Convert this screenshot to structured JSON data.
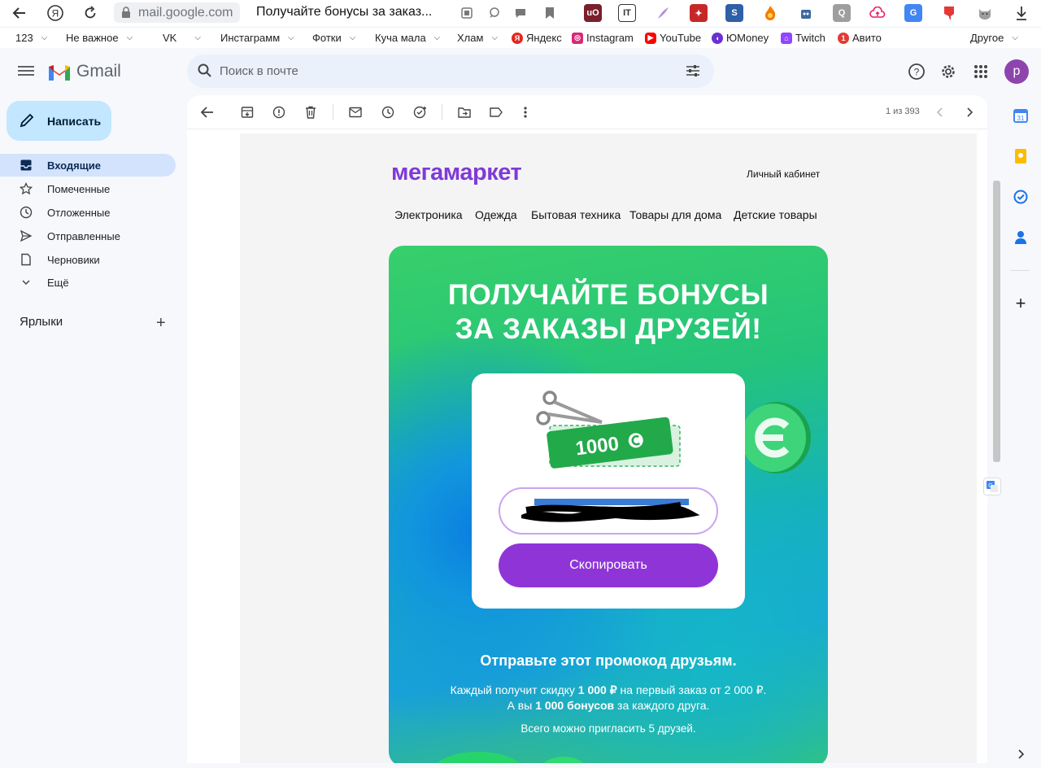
{
  "browser": {
    "url": "mail.google.com",
    "tab_title": "Получайте бонусы за заказ...",
    "extensions": [
      "ublock-icon",
      "it-icon",
      "feather-icon",
      "magic-wand-icon",
      "s-icon",
      "fire-icon",
      "robot-icon",
      "q-icon",
      "cloud-icon",
      "translate-icon",
      "pin-icon",
      "cat-icon"
    ]
  },
  "bookmarks": [
    {
      "label": "123",
      "folder": true
    },
    {
      "label": "Не важное",
      "folder": true
    },
    {
      "label": "VK",
      "folder": true
    },
    {
      "label": "Инстаграмм",
      "folder": true
    },
    {
      "label": "Фотки",
      "folder": true
    },
    {
      "label": "Куча мала",
      "folder": true
    },
    {
      "label": "Хлам",
      "folder": true
    },
    {
      "label": "Яндекс",
      "icon": "Я",
      "color": "#e52620"
    },
    {
      "label": "Instagram",
      "icon": "◎",
      "color": "#d62976"
    },
    {
      "label": "YouTube",
      "icon": "▶",
      "color": "#ff0000"
    },
    {
      "label": "ЮMoney",
      "icon": "◖",
      "color": "#6b2fd3"
    },
    {
      "label": "Twitch",
      "icon": "⌂",
      "color": "#9146ff"
    },
    {
      "label": "Авито",
      "icon": "1",
      "color": "#e53935"
    },
    {
      "label": "Другое",
      "folder": true
    }
  ],
  "gmail": {
    "logo_text": "Gmail",
    "search_placeholder": "Поиск в почте",
    "avatar_letter": "p",
    "compose_label": "Написать",
    "nav": [
      {
        "label": "Входящие",
        "icon": "inbox-icon",
        "active": true
      },
      {
        "label": "Помеченные",
        "icon": "star-icon"
      },
      {
        "label": "Отложенные",
        "icon": "clock-icon"
      },
      {
        "label": "Отправленные",
        "icon": "send-icon"
      },
      {
        "label": "Черновики",
        "icon": "draft-icon"
      },
      {
        "label": "Ещё",
        "icon": "chevron-down-icon"
      }
    ],
    "labels_title": "Ярлыки",
    "counter": "1 из 393"
  },
  "email": {
    "brand": "мегамаркет",
    "cabinet_link": "Личный кабинет",
    "categories": [
      "Электроника",
      "Одежда",
      "Бытовая техника",
      "Товары для дома",
      "Детские товары"
    ],
    "headline_1": "ПОЛУЧАЙТЕ БОНУСЫ",
    "headline_2": "ЗА ЗАКАЗЫ ДРУЗЕЙ!",
    "coupon_value": "1000",
    "copy_button": "Скопировать",
    "send_title": "Отправьте этот промокод друзьям.",
    "line1_a": "Каждый получит скидку ",
    "line1_b": "1 000 ₽",
    "line1_c": " на первый заказ от 2 000 ₽.",
    "line2_a": "А вы ",
    "line2_b": "1 000 бонусов",
    "line2_c": " за каждого друга.",
    "line3": "Всего можно пригласить 5 друзей.",
    "colors": {
      "brand": "#7f3ad8",
      "button": "#8f35d8",
      "banner_green": "#2fcb70",
      "banner_blue": "#0a7fe0"
    }
  }
}
